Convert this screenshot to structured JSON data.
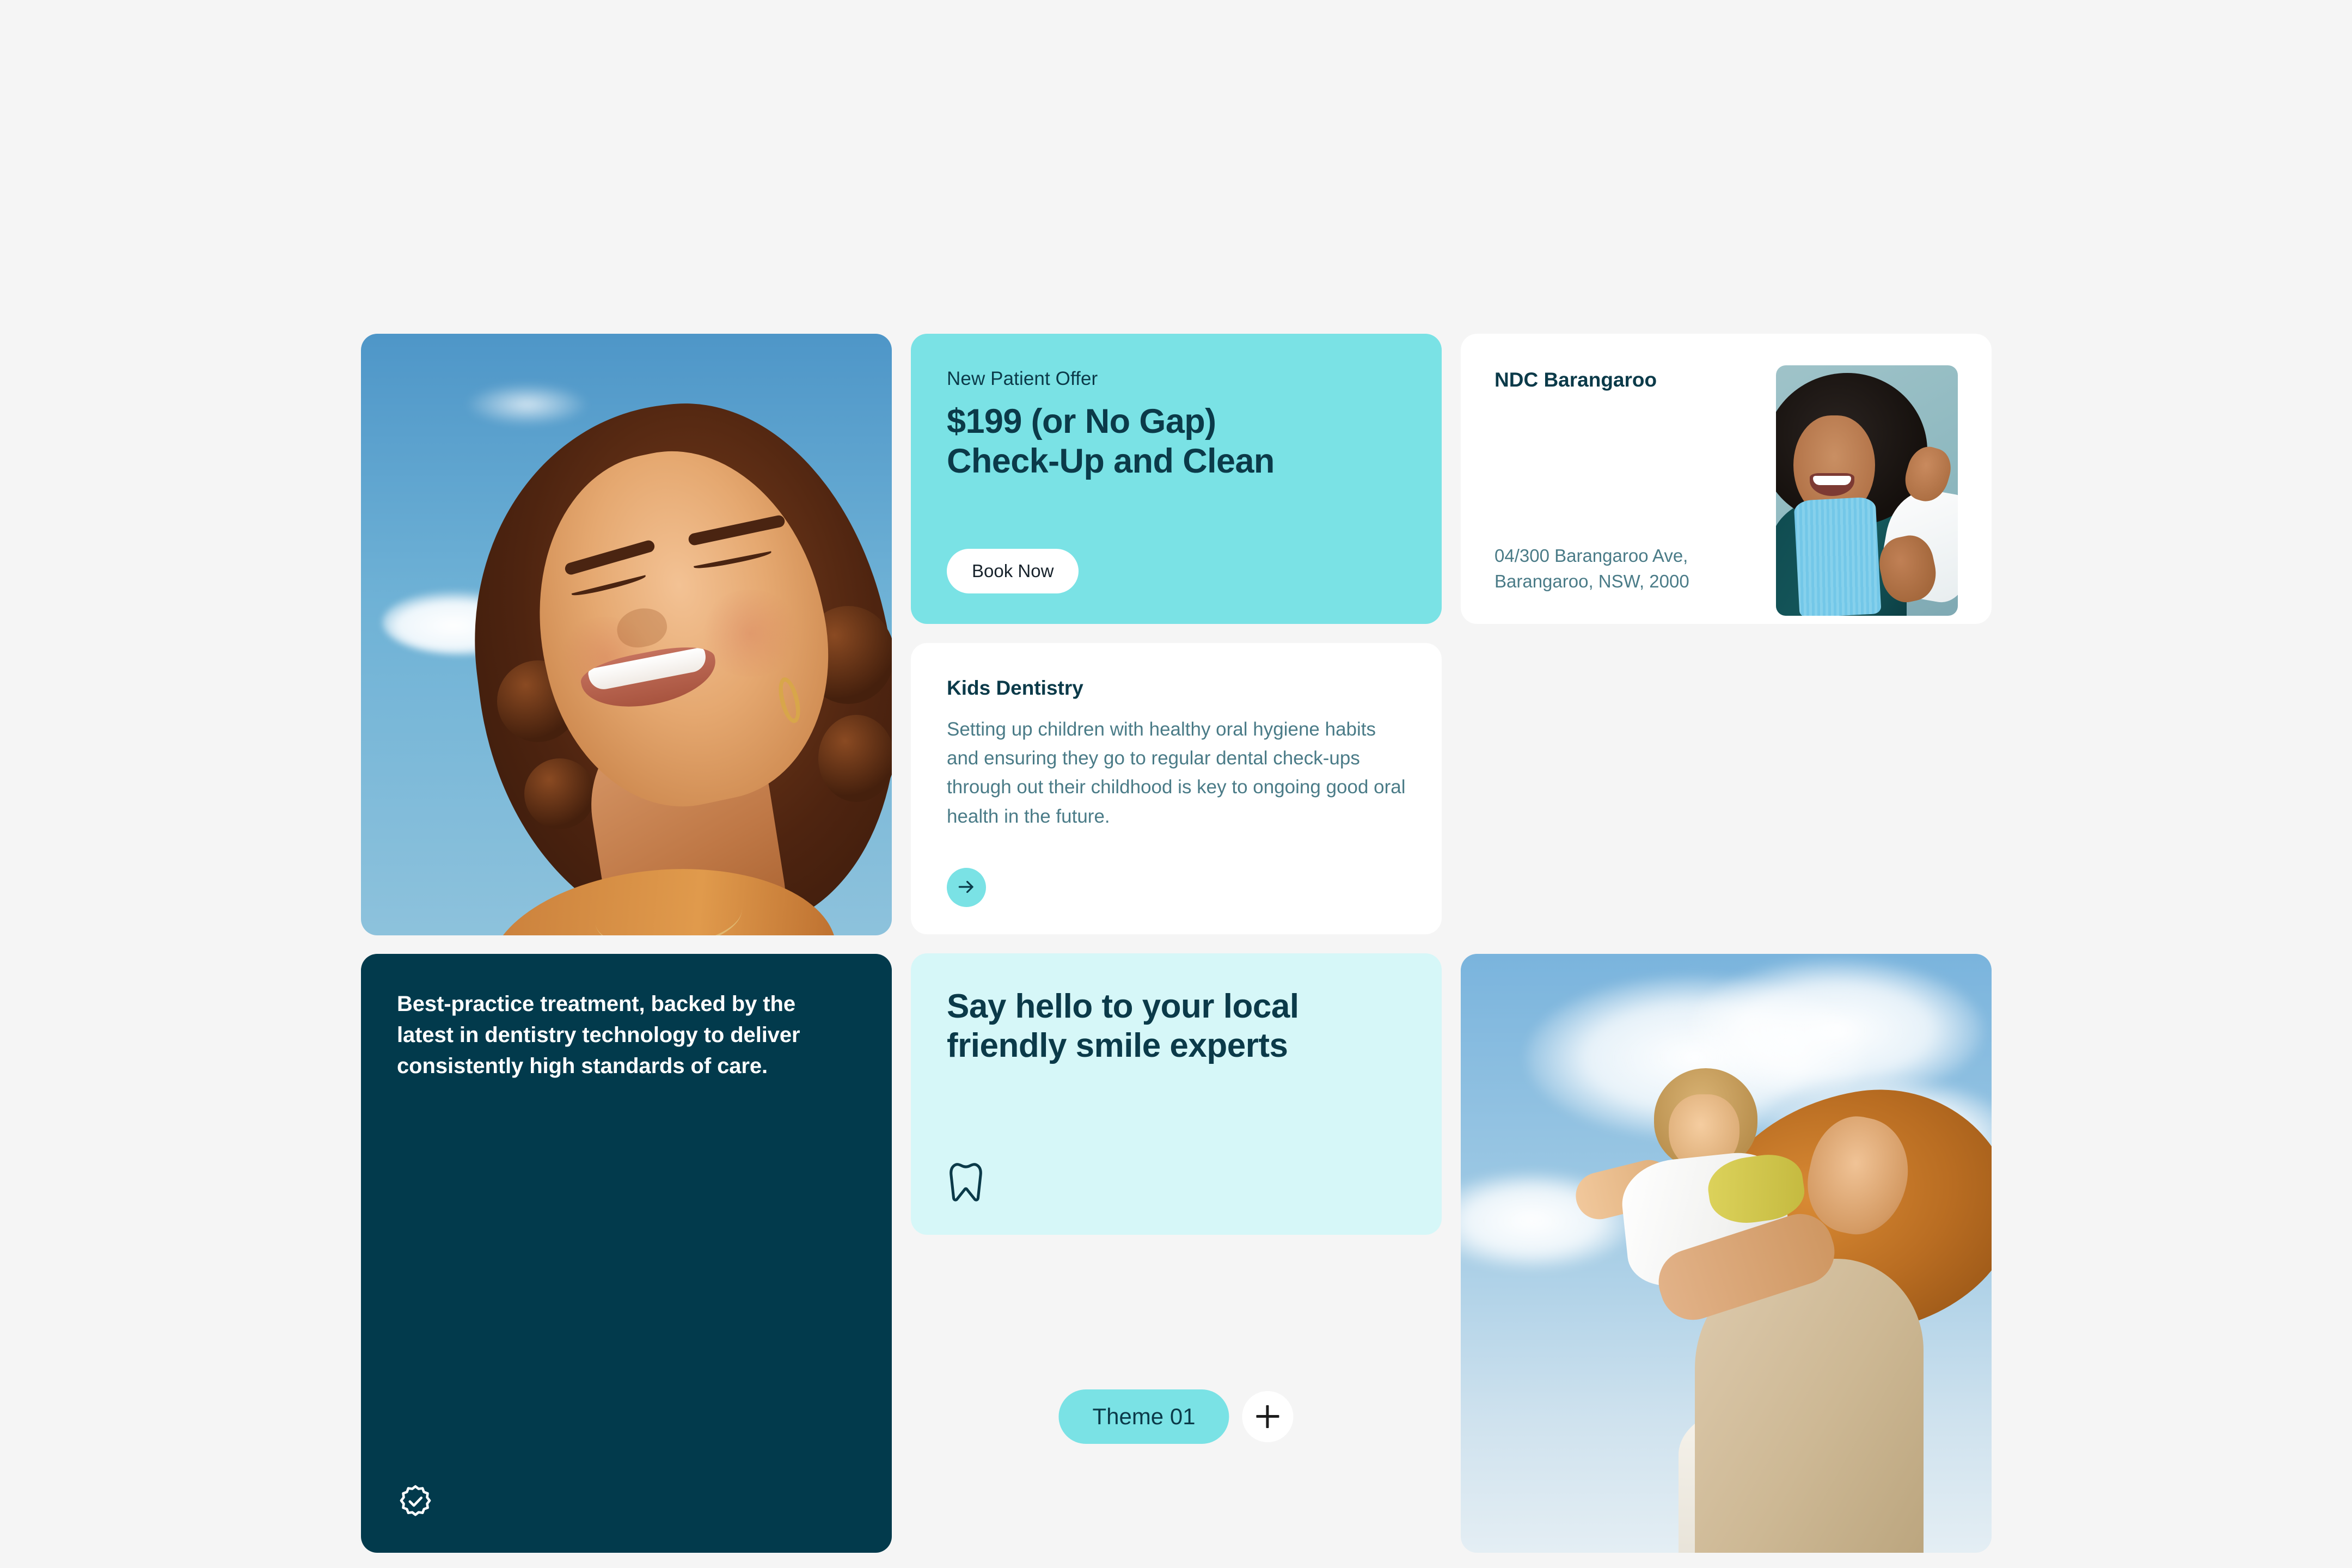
{
  "colors": {
    "page_background": "#f5f5f5",
    "accent_teal": "#7ae2e5",
    "light_cyan": "#d6f7f8",
    "dark_navy": "#023a4c",
    "muted_text": "#4a7b87",
    "card_white": "#ffffff"
  },
  "offer_card": {
    "eyebrow": "New Patient Offer",
    "title_line1": "$199 (or No Gap)",
    "title_line2": "Check-Up and Clean",
    "cta_label": "Book Now"
  },
  "kids_card": {
    "title": "Kids Dentistry",
    "body": "Setting up children with healthy oral hygiene habits and ensuring they go to regular dental check-ups through out their childhood is key to ongoing good oral health in the future.",
    "arrow_icon": "arrow-right-icon"
  },
  "clinic_card": {
    "name": "NDC Barangaroo",
    "address_line1": "04/300 Barangaroo Ave,",
    "address_line2": "Barangaroo, NSW, 2000",
    "photo_alt": "smiling-patient-in-dental-chair"
  },
  "dark_card": {
    "text": "Best-practice treatment, backed by the latest in dentistry technology to deliver consistently high standards of care.",
    "icon": "verified-badge-icon"
  },
  "hello_card": {
    "title_line1": "Say hello to your local",
    "title_line2": "friendly smile experts",
    "icon": "tooth-icon"
  },
  "hero_image": {
    "alt": "smiling-woman-looking-up-at-sky"
  },
  "family_image": {
    "alt": "mother-lifting-child-under-blue-sky"
  },
  "theme_bar": {
    "theme_label": "Theme 01",
    "add_label": "+",
    "add_icon": "plus-icon"
  }
}
